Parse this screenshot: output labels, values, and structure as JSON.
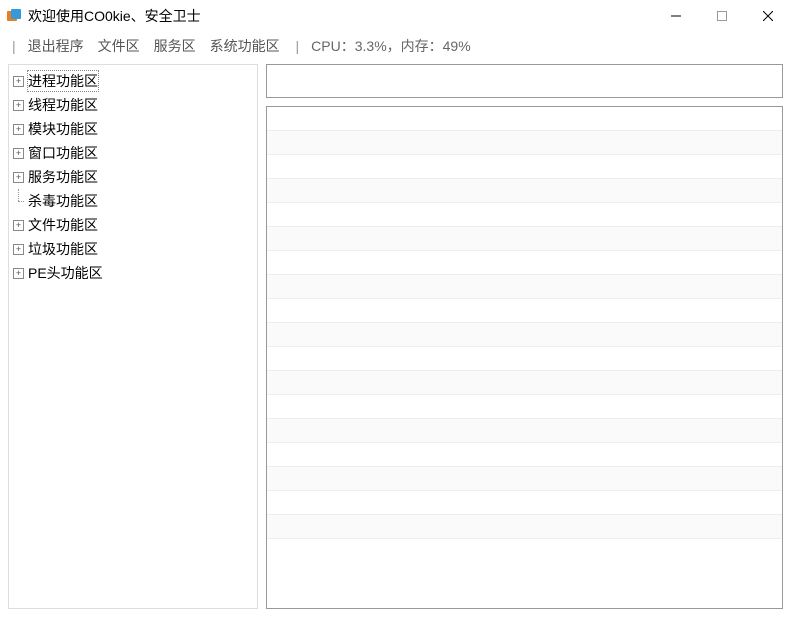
{
  "window": {
    "title": "欢迎使用CO0kie、安全卫士"
  },
  "menubar": {
    "items": [
      {
        "label": "退出程序"
      },
      {
        "label": "文件区"
      },
      {
        "label": "服务区"
      },
      {
        "label": "系统功能区"
      }
    ],
    "status": "CPU：3.3%，内存：49%"
  },
  "tree": {
    "items": [
      {
        "label": "进程功能区",
        "expandable": true,
        "selected": true
      },
      {
        "label": "线程功能区",
        "expandable": true,
        "selected": false
      },
      {
        "label": "模块功能区",
        "expandable": true,
        "selected": false
      },
      {
        "label": "窗口功能区",
        "expandable": true,
        "selected": false
      },
      {
        "label": "服务功能区",
        "expandable": true,
        "selected": false
      },
      {
        "label": "杀毒功能区",
        "expandable": false,
        "selected": false
      },
      {
        "label": "文件功能区",
        "expandable": true,
        "selected": false
      },
      {
        "label": "垃圾功能区",
        "expandable": true,
        "selected": false
      },
      {
        "label": "PE头功能区",
        "expandable": true,
        "selected": false
      }
    ]
  },
  "list": {
    "row_count": 18
  }
}
